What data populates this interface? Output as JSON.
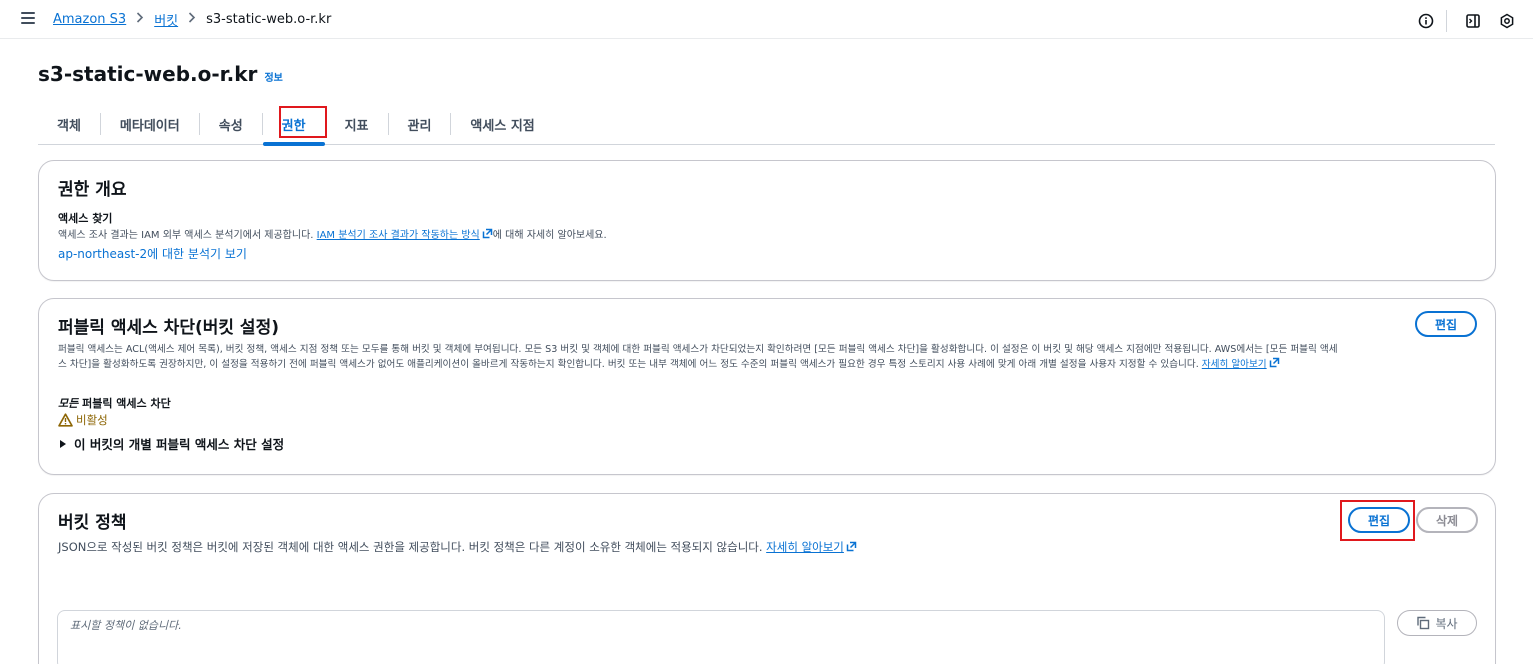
{
  "breadcrumb": {
    "items": [
      "Amazon S3",
      "버킷"
    ],
    "current": "s3-static-web.o-r.kr"
  },
  "header": {
    "title": "s3-static-web.o-r.kr",
    "info": "정보"
  },
  "tabs": [
    "객체",
    "메타데이터",
    "속성",
    "권한",
    "지표",
    "관리",
    "액세스 지점"
  ],
  "active_tab": "권한",
  "permissions_overview": {
    "title": "권한 개요",
    "access_findings_label": "액세스 찾기",
    "desc_prefix": "액세스 조사 결과는 IAM 외부 액세스 분석기에서 제공합니다. ",
    "desc_link": "IAM 분석기 조사 결과가 작동하는 방식",
    "desc_suffix": "에 대해 자세히 알아보세요.",
    "analyzer_link": "ap-northeast-2에 대한 분석기 보기"
  },
  "block_public_access": {
    "title": "퍼블릭 액세스 차단(버킷 설정)",
    "edit_label": "편집",
    "desc_line1": "퍼블릭 액세스는 ACL(액세스 제어 목록), 버킷 정책, 액세스 지점 정책 또는 모두를 통해 버킷 및 객체에 부여됩니다. 모든 S3 버킷 및 객체에 대한 퍼블릭 액세스가 차단되었는지 확인하려면 [모든 퍼블릭 액세스 차단]을 활성화합니다. 이 설정은 이 버킷 및 해당 액세스 지점에만 적용됩니다. AWS에서는 [모든 퍼블릭 액세",
    "desc_line2": "스 차단]을 활성화하도록 권장하지만, 이 설정을 적용하기 전에 퍼블릭 액세스가 없어도 애플리케이션이 올바르게 작동하는지 확인합니다. 버킷 또는 내부 객체에 어느 정도 수준의 퍼블릭 액세스가 필요한 경우 특정 스토리지 사용 사례에 맞게 아래 개별 설정을 사용자 지정할 수 있습니다. ",
    "learn_more": "자세히 알아보기",
    "all_label_em": "모든",
    "all_label_rest": " 퍼블릭 액세스 차단",
    "status": "비활성",
    "expand_label": "이 버킷의 개별 퍼블릭 액세스 차단 설정"
  },
  "bucket_policy": {
    "title": "버킷 정책",
    "edit_label": "편집",
    "delete_label": "삭제",
    "desc": "JSON으로 작성된 버킷 정책은 버킷에 저장된 객체에 대한 액세스 권한을 제공합니다. 버킷 정책은 다른 계정이 소유한 객체에는 적용되지 않습니다. ",
    "learn_more": "자세히 알아보기",
    "empty_text": "표시할 정책이 없습니다.",
    "copy_label": "복사"
  },
  "colors": {
    "accent": "#0972d3",
    "highlight": "#e0181d",
    "warning": "#8d6605"
  }
}
